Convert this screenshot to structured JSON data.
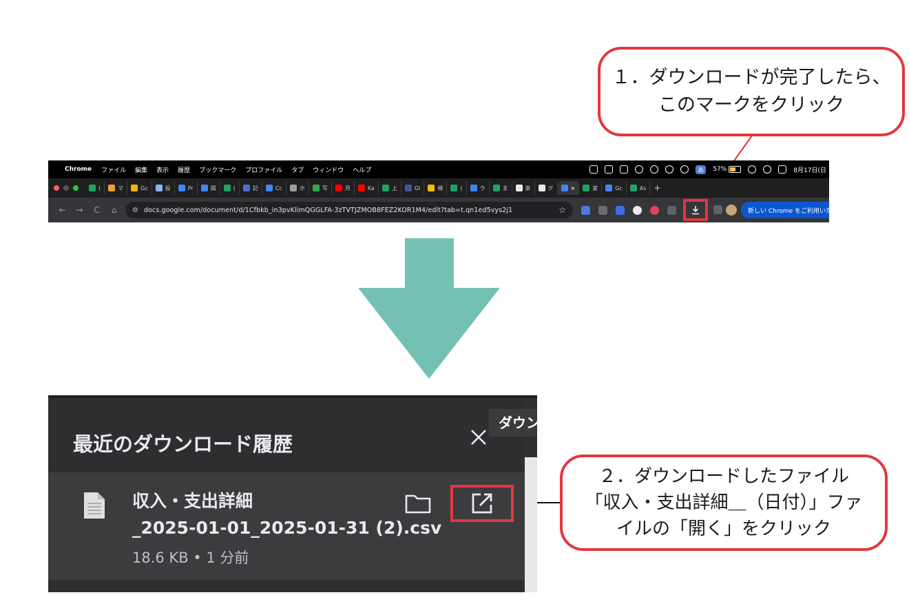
{
  "callouts": {
    "step1": {
      "line1": "１．ダウンロードが完了したら、",
      "line2": "このマークをクリック"
    },
    "step2": {
      "line1": "２．ダウンロードしたファイル",
      "line2": "「収入・支出詳細＿（日付）」ファ",
      "line3": "イルの「開く」をクリック"
    }
  },
  "colors": {
    "callout_border": "#e5363d",
    "arrow": "#74c0b2",
    "panel_bg": "#2d2e30",
    "row_bg": "#3c3c3e"
  },
  "menubar": {
    "app": "Chrome",
    "menus": [
      "ファイル",
      "編集",
      "表示",
      "履歴",
      "ブックマーク",
      "プロファイル",
      "タブ",
      "ウィンドウ",
      "ヘルプ"
    ],
    "status": {
      "ime": "あ",
      "battery": "57%",
      "date": "8月17日(日"
    }
  },
  "tabs": [
    {
      "label": "(",
      "color": "#1ea362"
    },
    {
      "label": "マ",
      "color": "#f29d38"
    },
    {
      "label": "Gc",
      "color": "#f4b400"
    },
    {
      "label": "投",
      "color": "#8ab4f8"
    },
    {
      "label": "Pr",
      "color": "#4285f4"
    },
    {
      "label": "図",
      "color": "#4285f4"
    },
    {
      "label": "(",
      "color": "#1ea362"
    },
    {
      "label": "記",
      "color": "#4b6ed6"
    },
    {
      "label": "Cc",
      "color": "#4285f4"
    },
    {
      "label": "ホ",
      "color": "#9e9e9e"
    },
    {
      "label": "写",
      "color": "#34a853"
    },
    {
      "label": "月",
      "color": "#ff0000"
    },
    {
      "label": "Ka",
      "color": "#ff0000"
    },
    {
      "label": "上",
      "color": "#1ea362"
    },
    {
      "label": "GI",
      "color": "#3c5a9a"
    },
    {
      "label": "検",
      "color": "#fbbc04"
    },
    {
      "label": "(",
      "color": "#1ea362"
    },
    {
      "label": "ラ",
      "color": "#4285f4"
    },
    {
      "label": "ま",
      "color": "#1ea362"
    },
    {
      "label": "家",
      "color": "#e8eaed"
    },
    {
      "label": "グ",
      "color": "#e8eaed"
    },
    {
      "label": "×",
      "color": "#4285f4",
      "active": true
    },
    {
      "label": "家",
      "color": "#1ea362"
    },
    {
      "label": "Gc",
      "color": "#4285f4"
    },
    {
      "label": "As",
      "color": "#1ea362"
    }
  ],
  "tab_add": "+",
  "toolbar": {
    "back": "←",
    "forward": "→",
    "reload": "C",
    "home": "⌂",
    "url": "docs.google.com/document/d/1Cfbkb_in3pvKlimQGGLFA-3zTVTJZMOB8FEZ2KOR1M4/edit?tab=t.qn1ed5vys2j1",
    "star": "☆",
    "chrome_notice": "新しい Chrome をご利用いただ"
  },
  "download_panel": {
    "title": "最近のダウンロード履歴",
    "tooltip": "ダウン",
    "file": {
      "name_line1": "収入・支出詳細",
      "name_line2": "_2025-01-01_2025-01-31 (2).csv",
      "meta": "18.6 KB • 1 分前"
    }
  }
}
